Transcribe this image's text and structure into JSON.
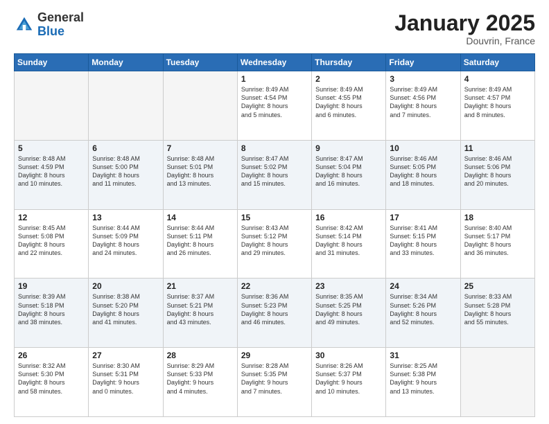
{
  "header": {
    "logo_general": "General",
    "logo_blue": "Blue",
    "month": "January 2025",
    "location": "Douvrin, France"
  },
  "weekdays": [
    "Sunday",
    "Monday",
    "Tuesday",
    "Wednesday",
    "Thursday",
    "Friday",
    "Saturday"
  ],
  "weeks": [
    [
      {
        "day": "",
        "info": ""
      },
      {
        "day": "",
        "info": ""
      },
      {
        "day": "",
        "info": ""
      },
      {
        "day": "1",
        "info": "Sunrise: 8:49 AM\nSunset: 4:54 PM\nDaylight: 8 hours\nand 5 minutes."
      },
      {
        "day": "2",
        "info": "Sunrise: 8:49 AM\nSunset: 4:55 PM\nDaylight: 8 hours\nand 6 minutes."
      },
      {
        "day": "3",
        "info": "Sunrise: 8:49 AM\nSunset: 4:56 PM\nDaylight: 8 hours\nand 7 minutes."
      },
      {
        "day": "4",
        "info": "Sunrise: 8:49 AM\nSunset: 4:57 PM\nDaylight: 8 hours\nand 8 minutes."
      }
    ],
    [
      {
        "day": "5",
        "info": "Sunrise: 8:48 AM\nSunset: 4:59 PM\nDaylight: 8 hours\nand 10 minutes."
      },
      {
        "day": "6",
        "info": "Sunrise: 8:48 AM\nSunset: 5:00 PM\nDaylight: 8 hours\nand 11 minutes."
      },
      {
        "day": "7",
        "info": "Sunrise: 8:48 AM\nSunset: 5:01 PM\nDaylight: 8 hours\nand 13 minutes."
      },
      {
        "day": "8",
        "info": "Sunrise: 8:47 AM\nSunset: 5:02 PM\nDaylight: 8 hours\nand 15 minutes."
      },
      {
        "day": "9",
        "info": "Sunrise: 8:47 AM\nSunset: 5:04 PM\nDaylight: 8 hours\nand 16 minutes."
      },
      {
        "day": "10",
        "info": "Sunrise: 8:46 AM\nSunset: 5:05 PM\nDaylight: 8 hours\nand 18 minutes."
      },
      {
        "day": "11",
        "info": "Sunrise: 8:46 AM\nSunset: 5:06 PM\nDaylight: 8 hours\nand 20 minutes."
      }
    ],
    [
      {
        "day": "12",
        "info": "Sunrise: 8:45 AM\nSunset: 5:08 PM\nDaylight: 8 hours\nand 22 minutes."
      },
      {
        "day": "13",
        "info": "Sunrise: 8:44 AM\nSunset: 5:09 PM\nDaylight: 8 hours\nand 24 minutes."
      },
      {
        "day": "14",
        "info": "Sunrise: 8:44 AM\nSunset: 5:11 PM\nDaylight: 8 hours\nand 26 minutes."
      },
      {
        "day": "15",
        "info": "Sunrise: 8:43 AM\nSunset: 5:12 PM\nDaylight: 8 hours\nand 29 minutes."
      },
      {
        "day": "16",
        "info": "Sunrise: 8:42 AM\nSunset: 5:14 PM\nDaylight: 8 hours\nand 31 minutes."
      },
      {
        "day": "17",
        "info": "Sunrise: 8:41 AM\nSunset: 5:15 PM\nDaylight: 8 hours\nand 33 minutes."
      },
      {
        "day": "18",
        "info": "Sunrise: 8:40 AM\nSunset: 5:17 PM\nDaylight: 8 hours\nand 36 minutes."
      }
    ],
    [
      {
        "day": "19",
        "info": "Sunrise: 8:39 AM\nSunset: 5:18 PM\nDaylight: 8 hours\nand 38 minutes."
      },
      {
        "day": "20",
        "info": "Sunrise: 8:38 AM\nSunset: 5:20 PM\nDaylight: 8 hours\nand 41 minutes."
      },
      {
        "day": "21",
        "info": "Sunrise: 8:37 AM\nSunset: 5:21 PM\nDaylight: 8 hours\nand 43 minutes."
      },
      {
        "day": "22",
        "info": "Sunrise: 8:36 AM\nSunset: 5:23 PM\nDaylight: 8 hours\nand 46 minutes."
      },
      {
        "day": "23",
        "info": "Sunrise: 8:35 AM\nSunset: 5:25 PM\nDaylight: 8 hours\nand 49 minutes."
      },
      {
        "day": "24",
        "info": "Sunrise: 8:34 AM\nSunset: 5:26 PM\nDaylight: 8 hours\nand 52 minutes."
      },
      {
        "day": "25",
        "info": "Sunrise: 8:33 AM\nSunset: 5:28 PM\nDaylight: 8 hours\nand 55 minutes."
      }
    ],
    [
      {
        "day": "26",
        "info": "Sunrise: 8:32 AM\nSunset: 5:30 PM\nDaylight: 8 hours\nand 58 minutes."
      },
      {
        "day": "27",
        "info": "Sunrise: 8:30 AM\nSunset: 5:31 PM\nDaylight: 9 hours\nand 0 minutes."
      },
      {
        "day": "28",
        "info": "Sunrise: 8:29 AM\nSunset: 5:33 PM\nDaylight: 9 hours\nand 4 minutes."
      },
      {
        "day": "29",
        "info": "Sunrise: 8:28 AM\nSunset: 5:35 PM\nDaylight: 9 hours\nand 7 minutes."
      },
      {
        "day": "30",
        "info": "Sunrise: 8:26 AM\nSunset: 5:37 PM\nDaylight: 9 hours\nand 10 minutes."
      },
      {
        "day": "31",
        "info": "Sunrise: 8:25 AM\nSunset: 5:38 PM\nDaylight: 9 hours\nand 13 minutes."
      },
      {
        "day": "",
        "info": ""
      }
    ]
  ]
}
